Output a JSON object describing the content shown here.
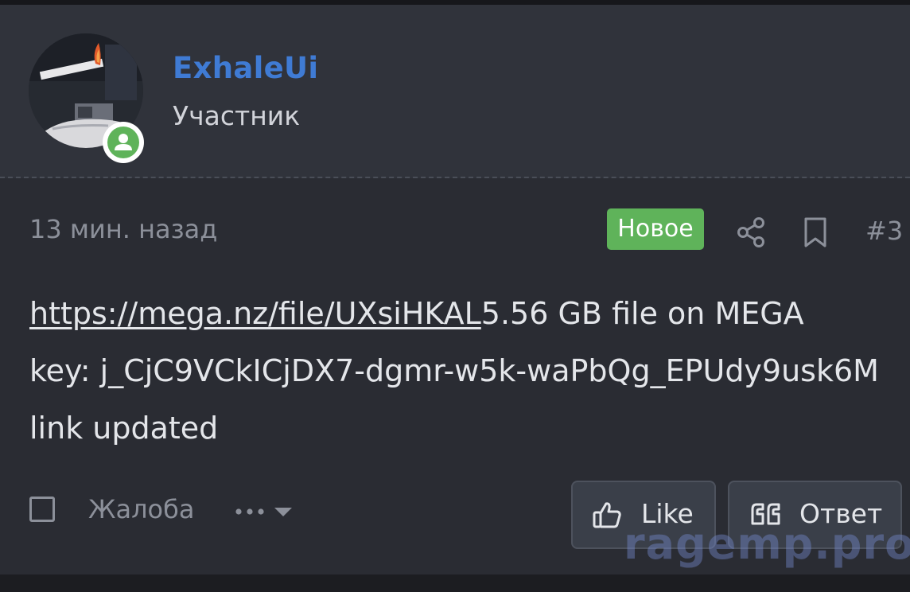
{
  "user": {
    "name": "ExhaleUi",
    "title": "Участник",
    "online_status_color": "#5fb35a"
  },
  "post": {
    "time": "13 мин. назад",
    "badge": "Новое",
    "number": "#3",
    "link_text": "https://mega.nz/file/UXsiHKAL",
    "link_suffix": "5.56 GB file on MEGA",
    "key_line": "key: j_CjC9VCkICjDX7-dgmr-w5k-waPbQg_EPUdy9usk6M",
    "update_line": "link updated"
  },
  "footer": {
    "report_label": "Жалоба",
    "more_icon": "ellipsis-chevron-icon",
    "like_label": "Like",
    "reply_label": "Ответ"
  },
  "watermark": "ragemp.pro",
  "colors": {
    "accent": "#3f7bd4",
    "badge": "#5fb35a",
    "background": "#2a2c33"
  }
}
